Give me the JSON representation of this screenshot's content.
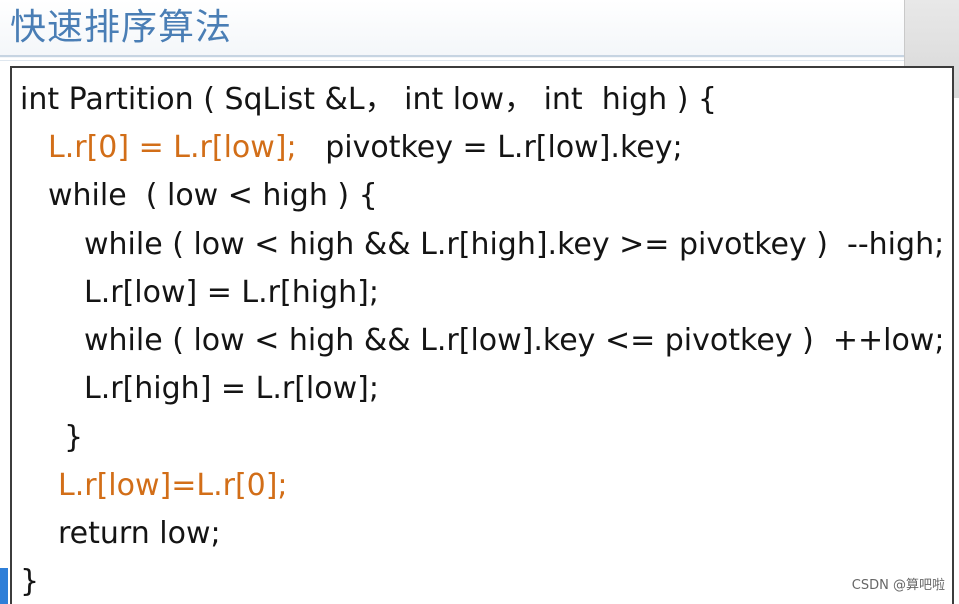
{
  "header": {
    "title": "快速排序算法"
  },
  "code": {
    "line1": "int Partition ( SqList &L， int low， int  high ) {",
    "line2_a": "L.r[0] = L.r[low];",
    "line2_b": "   pivotkey = L.r[low].key;",
    "line3": "while  ( low < high ) {",
    "line4": "while ( low < high && L.r[high].key >= pivotkey )  --high;",
    "line5": "L.r[low] = L.r[high];",
    "line6": "while ( low < high && L.r[low].key <= pivotkey )  ++low;",
    "line7": "L.r[high] = L.r[low];",
    "line8": "}",
    "line9": "L.r[low]=L.r[0];",
    "line10": "return low;",
    "line11": "}"
  },
  "watermark": "CSDN @算吧啦",
  "colors": {
    "title": "#4a7eb5",
    "highlight": "#d26e18",
    "code": "#141414",
    "marker": "#2f7fd8"
  }
}
